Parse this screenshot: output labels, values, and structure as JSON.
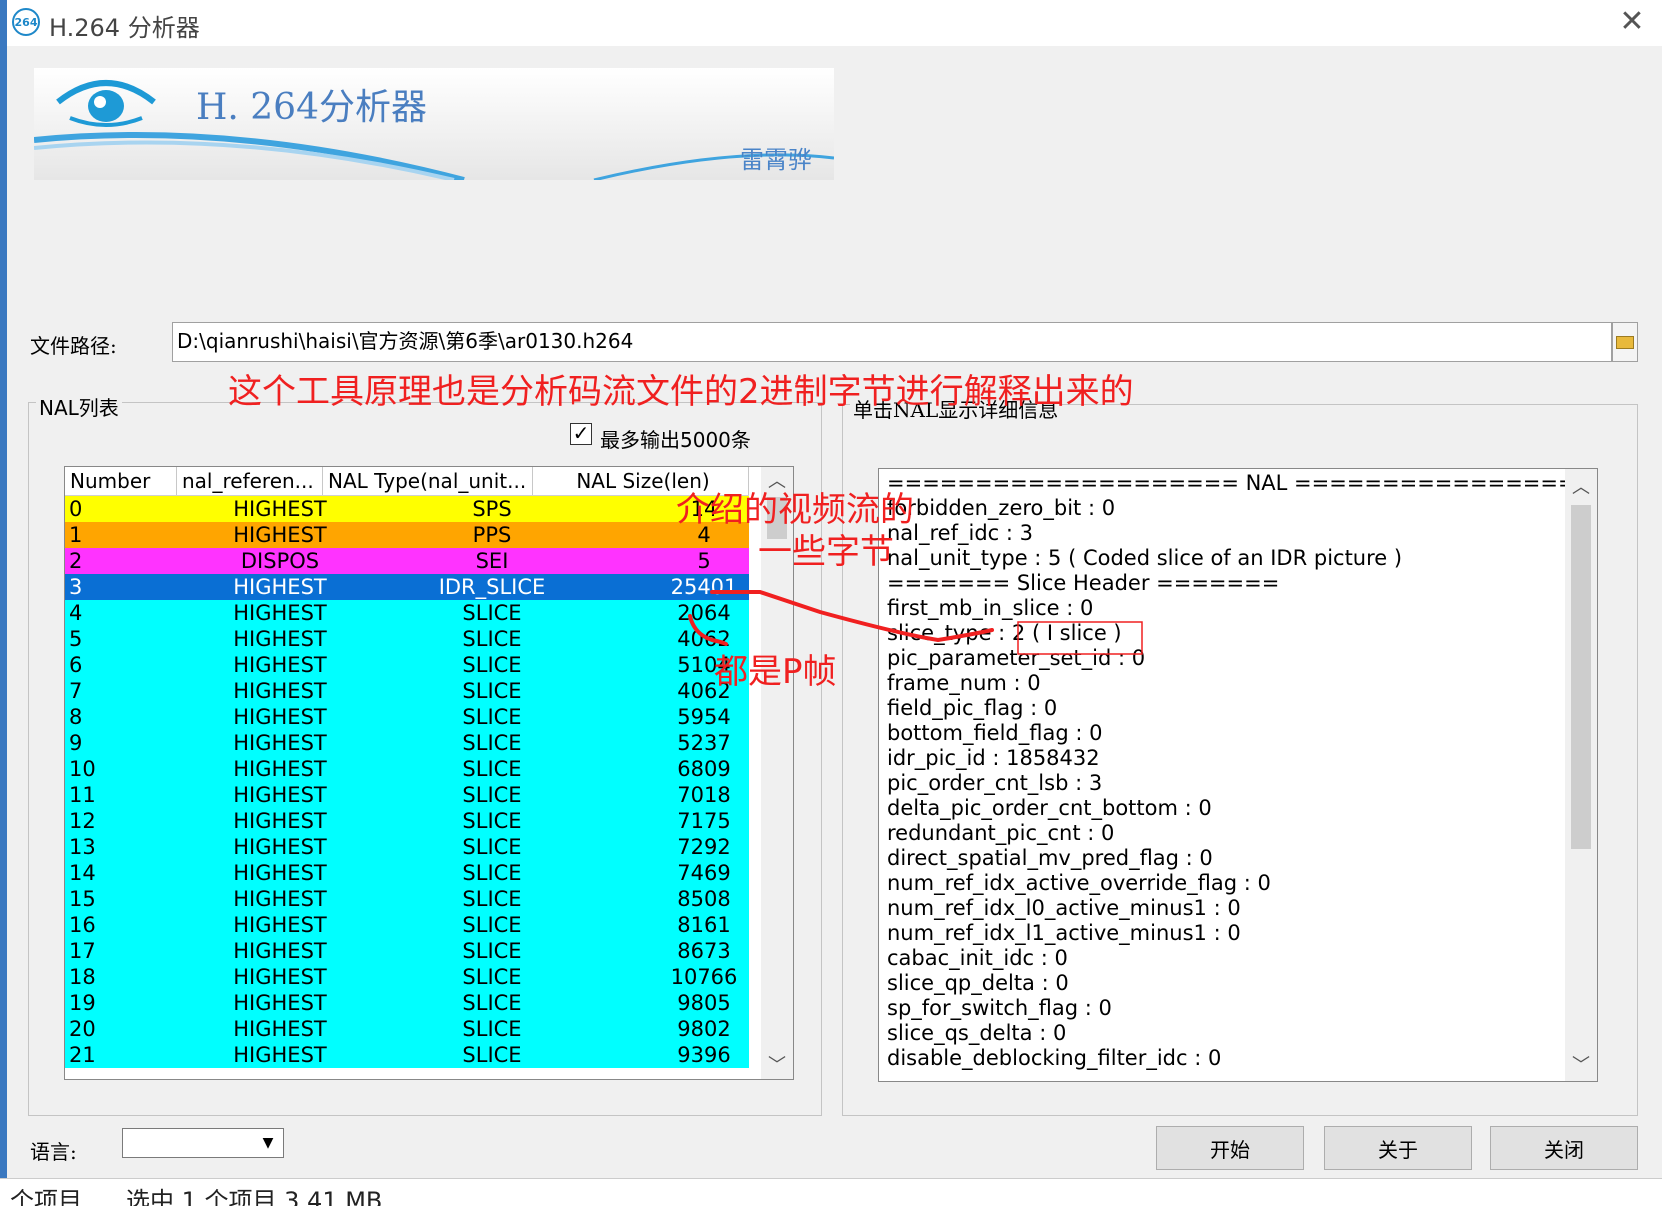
{
  "window": {
    "icon_text": "264",
    "title": "H.264 分析器",
    "close_glyph": "✕"
  },
  "banner": {
    "title": "H. 264分析器",
    "author": "雷霄骅"
  },
  "file": {
    "label": "文件路径:",
    "path": "D:\\qianrushi\\haisi\\官方资源\\第6季\\ar0130.h264"
  },
  "nal_group": {
    "title": "NAL列表",
    "max_output_checked": true,
    "max_output_label": "最多输出5000条",
    "columns": [
      "Number",
      "nal_referen...",
      "NAL Type(nal_unit...",
      "NAL Size(len)"
    ],
    "rows": [
      {
        "num": "0",
        "ref": "HIGHEST",
        "type": "SPS",
        "size": "14",
        "bg": "#ffff00"
      },
      {
        "num": "1",
        "ref": "HIGHEST",
        "type": "PPS",
        "size": "4",
        "bg": "#ffa500"
      },
      {
        "num": "2",
        "ref": "DISPOS",
        "type": "SEI",
        "size": "5",
        "bg": "#ff33ff"
      },
      {
        "num": "3",
        "ref": "HIGHEST",
        "type": "IDR_SLICE",
        "size": "25401",
        "bg": "#0a6fd4",
        "selected": true
      },
      {
        "num": "4",
        "ref": "HIGHEST",
        "type": "SLICE",
        "size": "2064",
        "bg": "#00ffff"
      },
      {
        "num": "5",
        "ref": "HIGHEST",
        "type": "SLICE",
        "size": "4062",
        "bg": "#00ffff"
      },
      {
        "num": "6",
        "ref": "HIGHEST",
        "type": "SLICE",
        "size": "5104",
        "bg": "#00ffff"
      },
      {
        "num": "7",
        "ref": "HIGHEST",
        "type": "SLICE",
        "size": "4062",
        "bg": "#00ffff"
      },
      {
        "num": "8",
        "ref": "HIGHEST",
        "type": "SLICE",
        "size": "5954",
        "bg": "#00ffff"
      },
      {
        "num": "9",
        "ref": "HIGHEST",
        "type": "SLICE",
        "size": "5237",
        "bg": "#00ffff"
      },
      {
        "num": "10",
        "ref": "HIGHEST",
        "type": "SLICE",
        "size": "6809",
        "bg": "#00ffff"
      },
      {
        "num": "11",
        "ref": "HIGHEST",
        "type": "SLICE",
        "size": "7018",
        "bg": "#00ffff"
      },
      {
        "num": "12",
        "ref": "HIGHEST",
        "type": "SLICE",
        "size": "7175",
        "bg": "#00ffff"
      },
      {
        "num": "13",
        "ref": "HIGHEST",
        "type": "SLICE",
        "size": "7292",
        "bg": "#00ffff"
      },
      {
        "num": "14",
        "ref": "HIGHEST",
        "type": "SLICE",
        "size": "7469",
        "bg": "#00ffff"
      },
      {
        "num": "15",
        "ref": "HIGHEST",
        "type": "SLICE",
        "size": "8508",
        "bg": "#00ffff"
      },
      {
        "num": "16",
        "ref": "HIGHEST",
        "type": "SLICE",
        "size": "8161",
        "bg": "#00ffff"
      },
      {
        "num": "17",
        "ref": "HIGHEST",
        "type": "SLICE",
        "size": "8673",
        "bg": "#00ffff"
      },
      {
        "num": "18",
        "ref": "HIGHEST",
        "type": "SLICE",
        "size": "10766",
        "bg": "#00ffff"
      },
      {
        "num": "19",
        "ref": "HIGHEST",
        "type": "SLICE",
        "size": "9805",
        "bg": "#00ffff"
      },
      {
        "num": "20",
        "ref": "HIGHEST",
        "type": "SLICE",
        "size": "9802",
        "bg": "#00ffff"
      },
      {
        "num": "21",
        "ref": "HIGHEST",
        "type": "SLICE",
        "size": "9396",
        "bg": "#00ffff"
      }
    ]
  },
  "detail_group": {
    "title": "单击NAL显示详细信息",
    "lines": [
      "==================== NAL ====================",
      "forbidden_zero_bit : 0",
      "nal_ref_idc : 3",
      "nal_unit_type : 5 ( Coded slice of an IDR picture )",
      "======= Slice Header =======",
      " first_mb_in_slice : 0",
      " slice_type : 2 ( I slice )",
      " pic_parameter_set_id : 0",
      " frame_num : 0",
      " field_pic_flag : 0",
      " bottom_field_flag : 0",
      " idr_pic_id : 1858432",
      " pic_order_cnt_lsb : 3",
      " delta_pic_order_cnt_bottom : 0",
      " redundant_pic_cnt : 0",
      " direct_spatial_mv_pred_flag : 0",
      " num_ref_idx_active_override_flag : 0",
      " num_ref_idx_l0_active_minus1 : 0",
      " num_ref_idx_l1_active_minus1 : 0",
      " cabac_init_idc : 0",
      " slice_qp_delta : 0",
      " sp_for_switch_flag : 0",
      " slice_qs_delta : 0",
      " disable_deblocking_filter_idc : 0"
    ]
  },
  "bottom": {
    "language_label": "语言:",
    "language_value": "",
    "buttons": {
      "start": "开始",
      "about": "关于",
      "close": "关闭"
    }
  },
  "annotations": {
    "principle": "这个工具原理也是分析码流文件的2进制字节进行解释出来的",
    "intro_line1": "介绍的视频流的",
    "intro_line2": "一些字节",
    "p_frames": "都是P帧"
  },
  "taskbar": {
    "items_text": "个项目",
    "selected_text": "选中 1 个项目  3.41 MB"
  },
  "colors": {
    "annotation": "#f02020",
    "selected_row": "#0a6fd4",
    "banner_text": "#4a7ec0"
  }
}
